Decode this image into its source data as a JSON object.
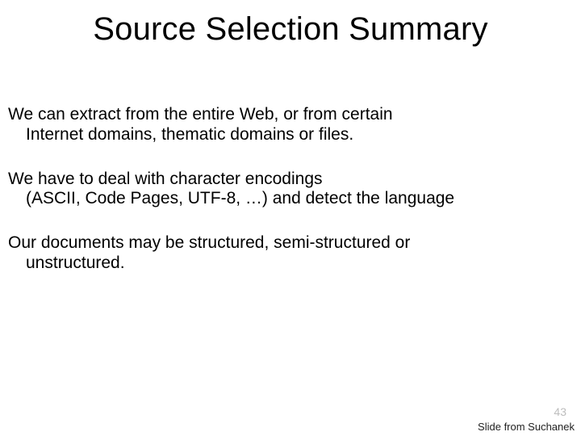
{
  "title": "Source Selection Summary",
  "paragraphs": [
    {
      "line1": "We can extract from the entire Web, or from certain",
      "line2": "Internet domains, thematic domains or files."
    },
    {
      "line1": "We have to deal with character  encodings",
      "line2": "(ASCII, Code Pages, UTF-8, …) and detect the language"
    },
    {
      "line1": "Our documents may be structured, semi-structured or",
      "line2": "unstructured."
    }
  ],
  "page_number": "43",
  "credit": "Slide from Suchanek"
}
